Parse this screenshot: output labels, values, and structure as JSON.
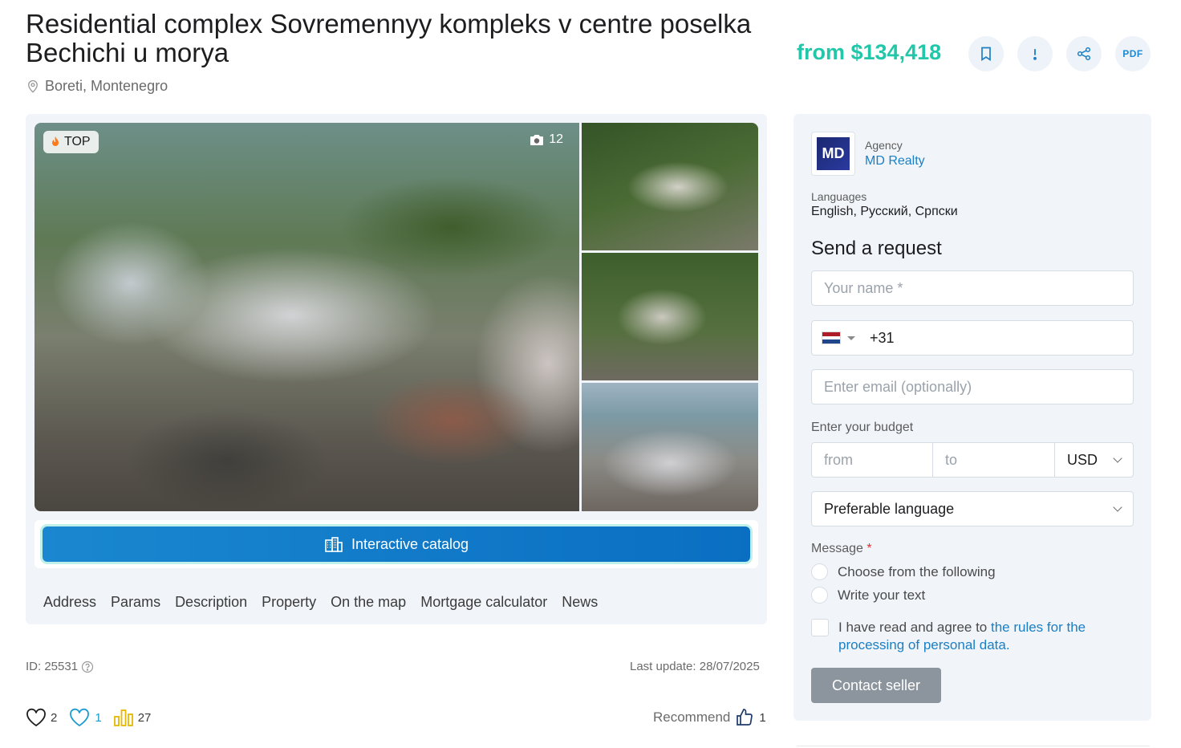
{
  "title": "Residential complex Sovremennyy kompleks v centre poselka Bechichi u morya",
  "location": "Boreti, Montenegro",
  "price": "from $134,418",
  "actions": {
    "bookmark_icon": "bookmark-icon",
    "report_icon": "exclamation-icon",
    "share_icon": "share-icon",
    "pdf_label": "PDF"
  },
  "gallery": {
    "badge": "TOP",
    "photo_count": "12"
  },
  "catalog_button": "Interactive catalog",
  "tabs": [
    "Address",
    "Params",
    "Description",
    "Property",
    "On the map",
    "Mortgage calculator",
    "News"
  ],
  "meta": {
    "id": "ID: 25531",
    "last_update": "Last update: 28/07/2025"
  },
  "stats": {
    "favorites": "2",
    "likes": "1",
    "views": "27",
    "recommend_label": "Recommend",
    "recommend_count": "1"
  },
  "agency": {
    "logo_text": "MD",
    "label": "Agency",
    "name": "MD Realty",
    "languages_label": "Languages",
    "languages": "English, Русский, Српски"
  },
  "form": {
    "title": "Send a request",
    "name_placeholder": "Your name *",
    "phone_code": "+31",
    "email_placeholder": "Enter email (optionally)",
    "budget_label": "Enter your budget",
    "budget_from": "from",
    "budget_to": "to",
    "currency": "USD",
    "language_select": "Preferable language",
    "message_label": "Message",
    "message_required": "*",
    "option_choose": "Choose from the following",
    "option_write": "Write your text",
    "agree_text": "I have read and agree to ",
    "agree_link": "the rules for the processing of personal data.",
    "submit": "Contact seller"
  },
  "colors": {
    "price": "#22c7a9",
    "accent": "#1a7fc4",
    "catalog_button": "#0a6fc2",
    "submit_button": "#8c949d"
  }
}
